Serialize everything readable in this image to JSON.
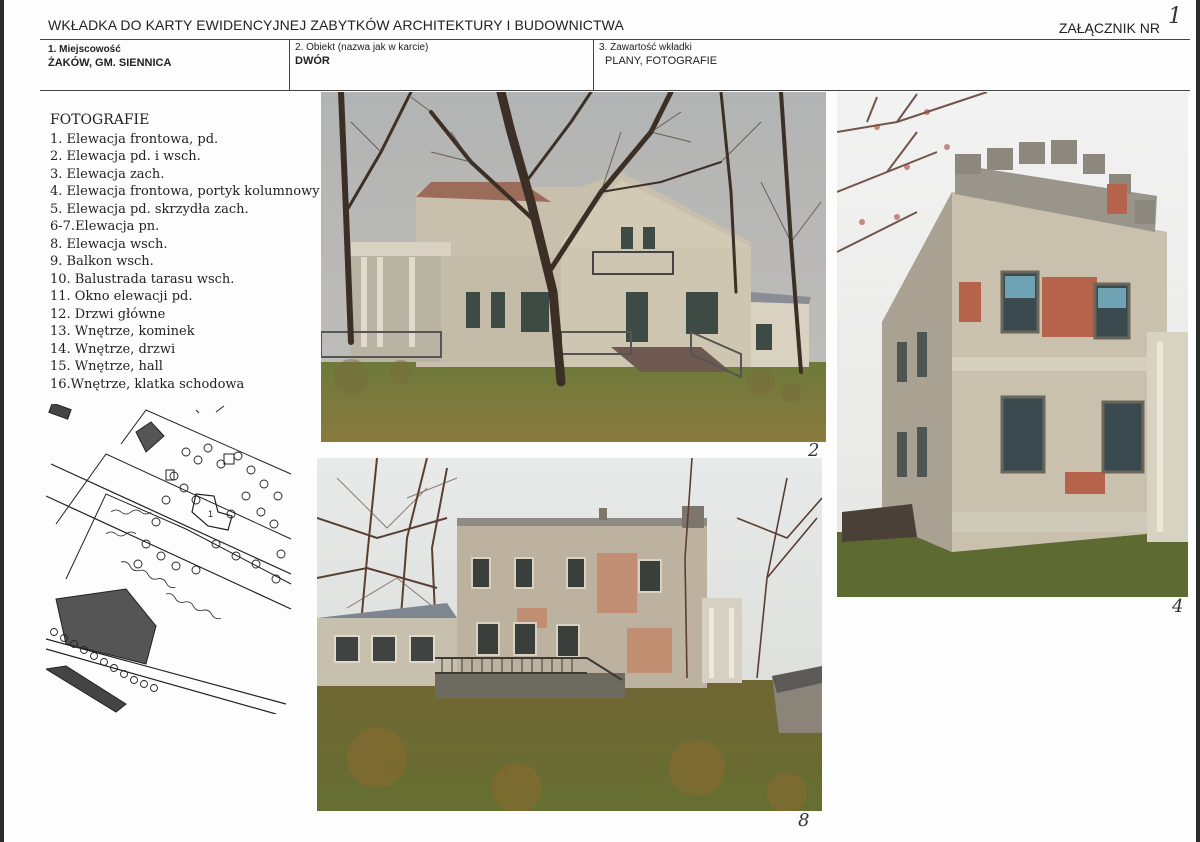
{
  "header": {
    "title": "WKŁADKA DO KARTY EWIDENCYJNEJ ZABYTKÓW ARCHITEKTURY I BUDOWNICTWA",
    "annex_label": "ZAŁĄCZNIK NR",
    "annex_number": "1"
  },
  "fields": {
    "locality_label": "1. Miejscowość",
    "locality_value": "ŻAKÓW, GM. SIENNICA",
    "object_label": "2. Obiekt (nazwa jak w karcie)",
    "object_value": "DWÓR",
    "contents_label": "3. Zawartość wkładki",
    "contents_value": "PLANY, FOTOGRAFIE"
  },
  "photo_list": {
    "heading": "FOTOGRAFIE",
    "items": [
      "1. Elewacja frontowa, pd.",
      "2. Elewacja pd. i wsch.",
      "3. Elewacja zach.",
      "4. Elewacja frontowa, portyk kolumnowy",
      "5. Elewacja pd. skrzydła zach.",
      "6-7.Elewacja pn.",
      "8. Elewacja wsch.",
      "9. Balkon wsch.",
      "10. Balustrada tarasu wsch.",
      "11. Okno elewacji pd.",
      "12. Drzwi główne",
      "13. Wnętrze, kominek",
      "14. Wnętrze, drzwi",
      "15. Wnętrze, hall",
      "16.Wnętrze, klatka schodowa"
    ]
  },
  "photos": {
    "p2_number": "2",
    "p4_number": "4",
    "p8_number": "8"
  },
  "siteplan": {
    "marker": "1"
  },
  "colors": {
    "paper": "#fdfdfd",
    "grass": "#6f7a3c",
    "plaster": "#c9c0ae",
    "brick": "#b5634a",
    "sky": "#e8eaea"
  }
}
